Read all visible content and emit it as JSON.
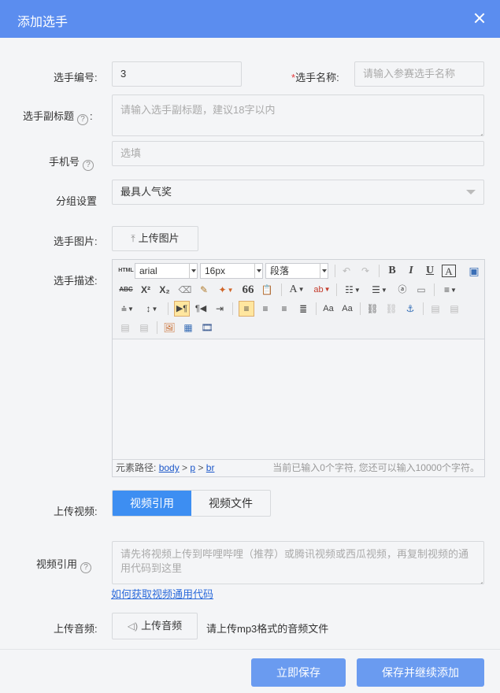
{
  "dialog": {
    "title": "添加选手"
  },
  "form": {
    "number": {
      "label": "选手编号:",
      "value": "3"
    },
    "name": {
      "required_mark": "*",
      "label": "选手名称:",
      "placeholder": "请输入参赛选手名称"
    },
    "subtitle": {
      "label": "选手副标题",
      "help": "?",
      "suffix": ":",
      "placeholder": "请输入选手副标题，建议18字以内"
    },
    "phone": {
      "label": "手机号",
      "help": "?",
      "placeholder": "选填"
    },
    "group": {
      "label": "分组设置",
      "selected": "最具人气奖"
    },
    "image": {
      "label": "选手图片:",
      "button": "上传图片"
    },
    "description": {
      "label": "选手描述:",
      "toolbar": {
        "source_label": "HTML",
        "font_family": "arial",
        "font_size": "16px",
        "paragraph": "段落",
        "bold": "B",
        "italic": "I",
        "underline": "U",
        "font_border": "A",
        "strikethrough": "ABC",
        "superscript": "X²",
        "subscript": "X₂",
        "blockquote": "66",
        "font_color": "A",
        "ltr": "▶¶",
        "rtl": "¶◀"
      },
      "status_path_label": "元素路径:",
      "status_path": [
        "body",
        "p",
        "br"
      ],
      "char_count": "当前已输入0个字符, 您还可以输入10000个字符。"
    },
    "video": {
      "label": "上传视频:",
      "tabs": [
        "视频引用",
        "视频文件"
      ],
      "active_tab": "视频引用"
    },
    "video_ref": {
      "label": "视频引用",
      "help": "?",
      "placeholder": "请先将视频上传到哔哩哔哩（推荐）或腾讯视频或西瓜视频，再复制视频的通用代码到这里",
      "link": "如何获取视频通用代码"
    },
    "audio": {
      "label": "上传音频:",
      "button": "上传音频",
      "hint": "请上传mp3格式的音频文件"
    }
  },
  "footer": {
    "save": "立即保存",
    "save_continue": "保存并继续添加"
  },
  "colors": {
    "titlebar": "#5b8def",
    "primary_button": "#6a9bf0",
    "active_tab": "#3d8ef2",
    "link": "#2c6bdb",
    "required": "#e4393c"
  }
}
